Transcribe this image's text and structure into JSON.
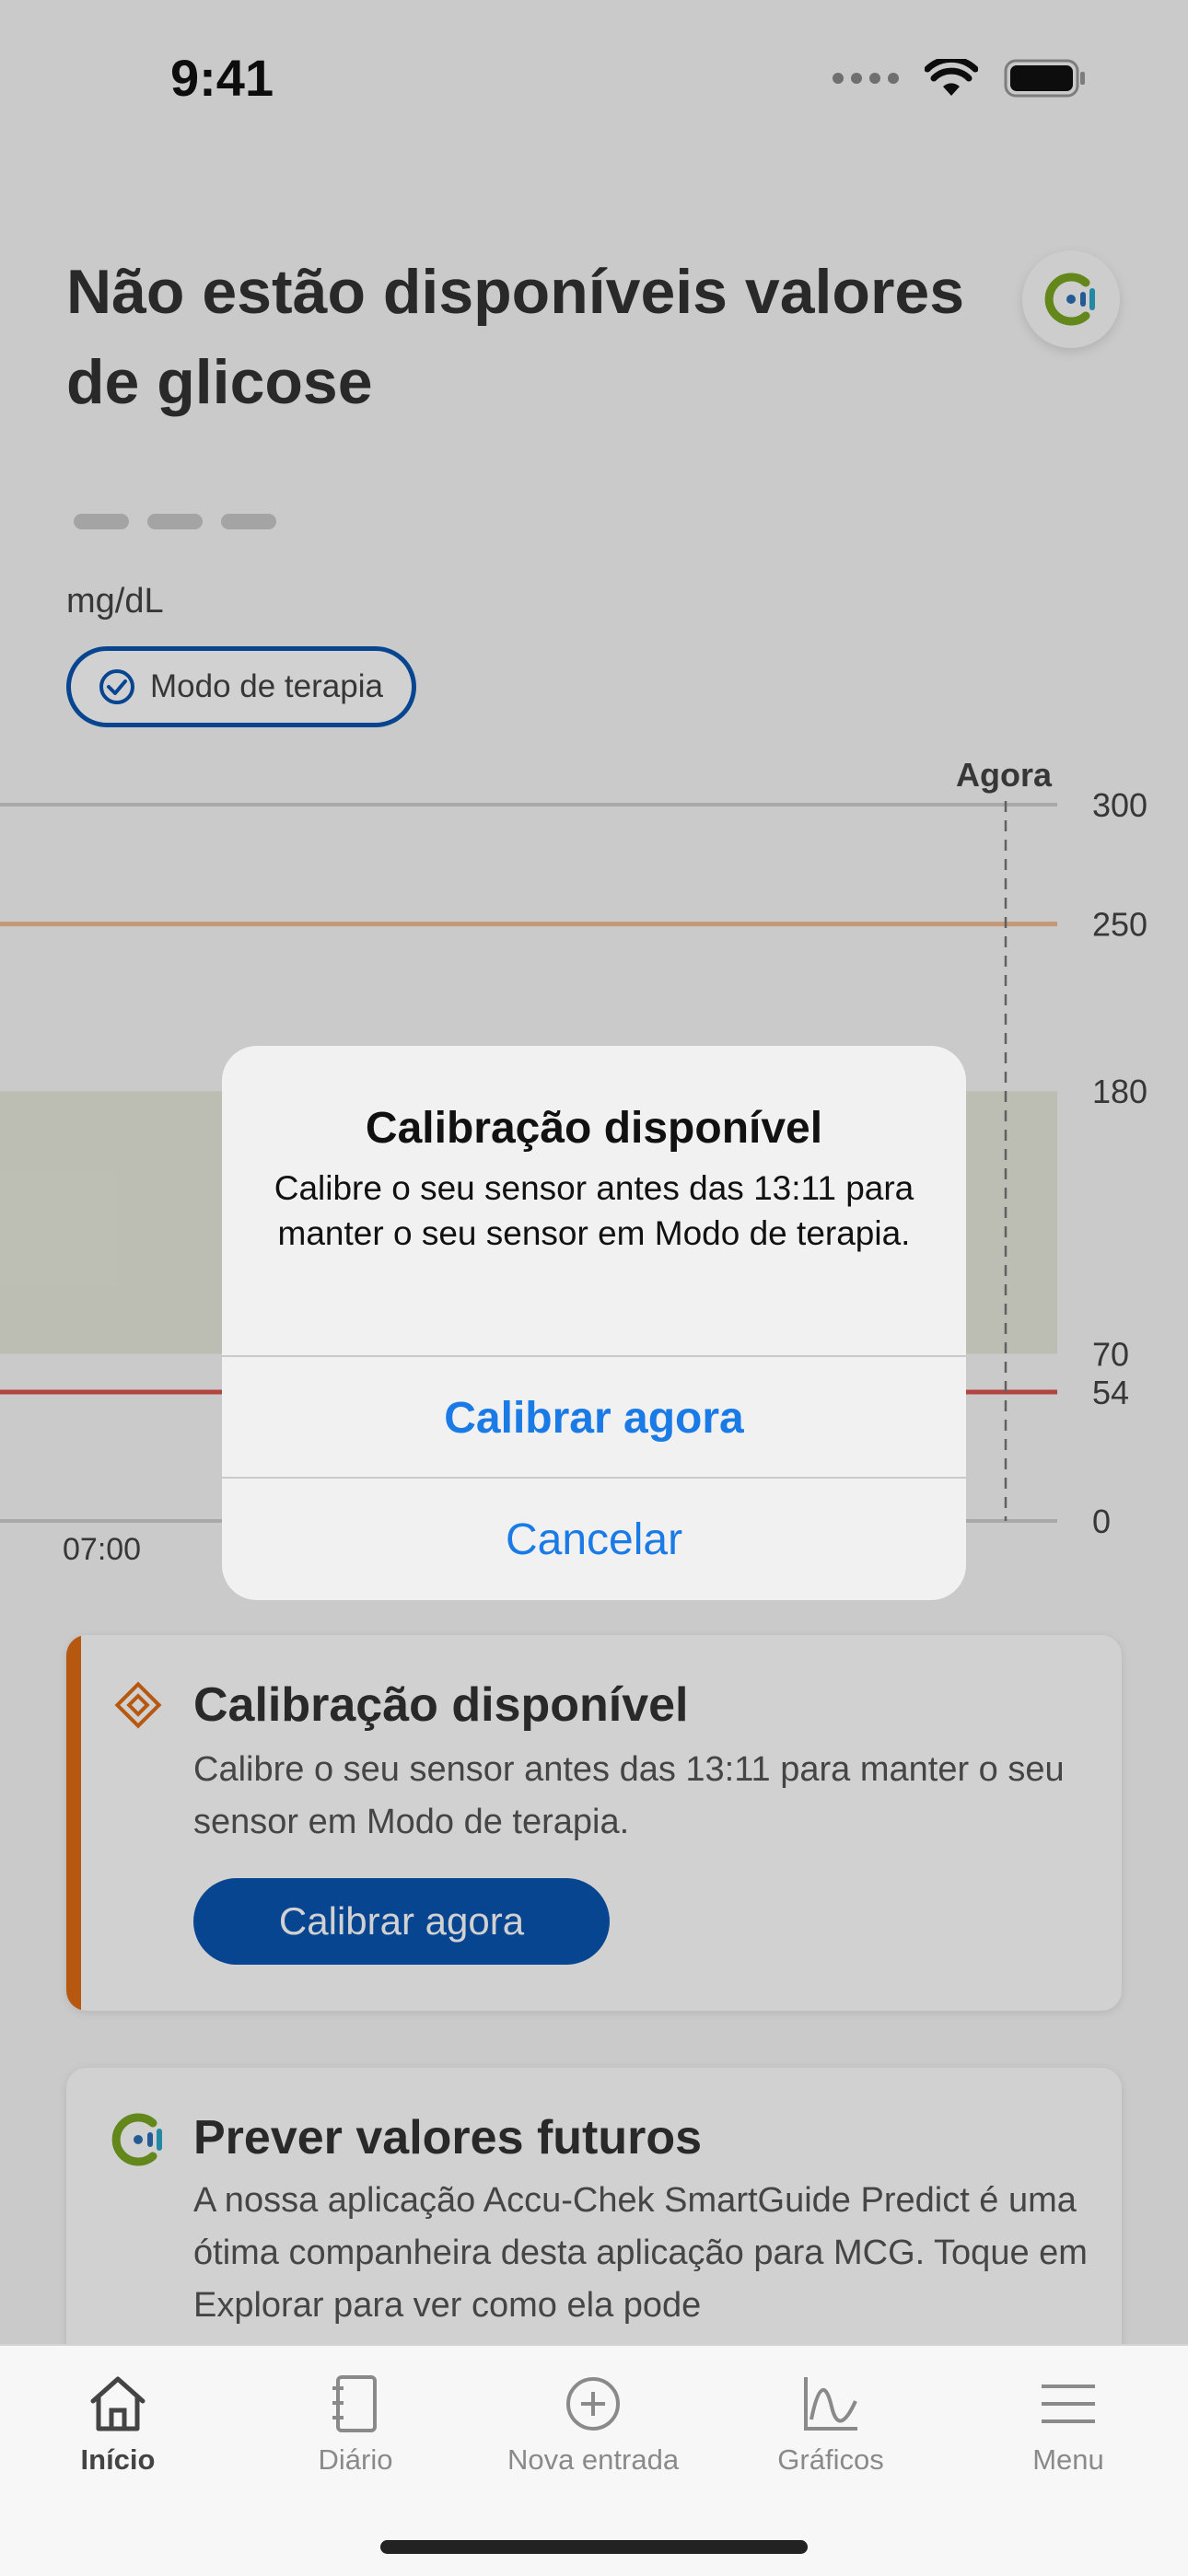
{
  "status_bar": {
    "time": "9:41"
  },
  "header": {
    "title": "Não estão disponíveis valores de glicose",
    "unit": "mg/dL",
    "therapy_mode_label": "Modo de terapia",
    "logo_icon": "accu-chek-logo-icon"
  },
  "chart_data": {
    "type": "line",
    "now_label": "Agora",
    "x_tick_labels": [
      "07:00"
    ],
    "y_tick_labels": [
      "300",
      "250",
      "180",
      "70",
      "54",
      "0"
    ],
    "ylim": [
      0,
      300
    ],
    "target_range": [
      70,
      180
    ],
    "high_threshold": 250,
    "low_threshold": 54,
    "series": [],
    "colors": {
      "target_band": "#e6e8dc",
      "high_line": "#f0b98f",
      "low_line": "#d9534f"
    }
  },
  "calibration_card": {
    "title": "Calibração disponível",
    "text": "Calibre o seu sensor antes das 13:11 para manter o seu sensor em Modo de terapia.",
    "button": "Calibrar agora"
  },
  "predict_card": {
    "title": "Prever valores futuros",
    "text": "A nossa aplicação Accu-Chek SmartGuide Predict é uma ótima companheira desta aplicação para MCG. Toque em Explorar para ver como ela pode"
  },
  "alert": {
    "title": "Calibração disponível",
    "message": "Calibre o seu sensor antes das 13:11 para manter o seu sensor em Modo de terapia.",
    "primary": "Calibrar agora",
    "cancel": "Cancelar"
  },
  "tabs": [
    {
      "label": "Início",
      "icon": "home-icon",
      "active": true
    },
    {
      "label": "Diário",
      "icon": "diary-icon",
      "active": false
    },
    {
      "label": "Nova entrada",
      "icon": "plus-circle-icon",
      "active": false
    },
    {
      "label": "Gráficos",
      "icon": "chart-icon",
      "active": false
    },
    {
      "label": "Menu",
      "icon": "menu-icon",
      "active": false
    }
  ],
  "colors": {
    "primary": "#0a55b0",
    "accent_orange": "#e06c15",
    "link_blue": "#1a7ae6"
  }
}
